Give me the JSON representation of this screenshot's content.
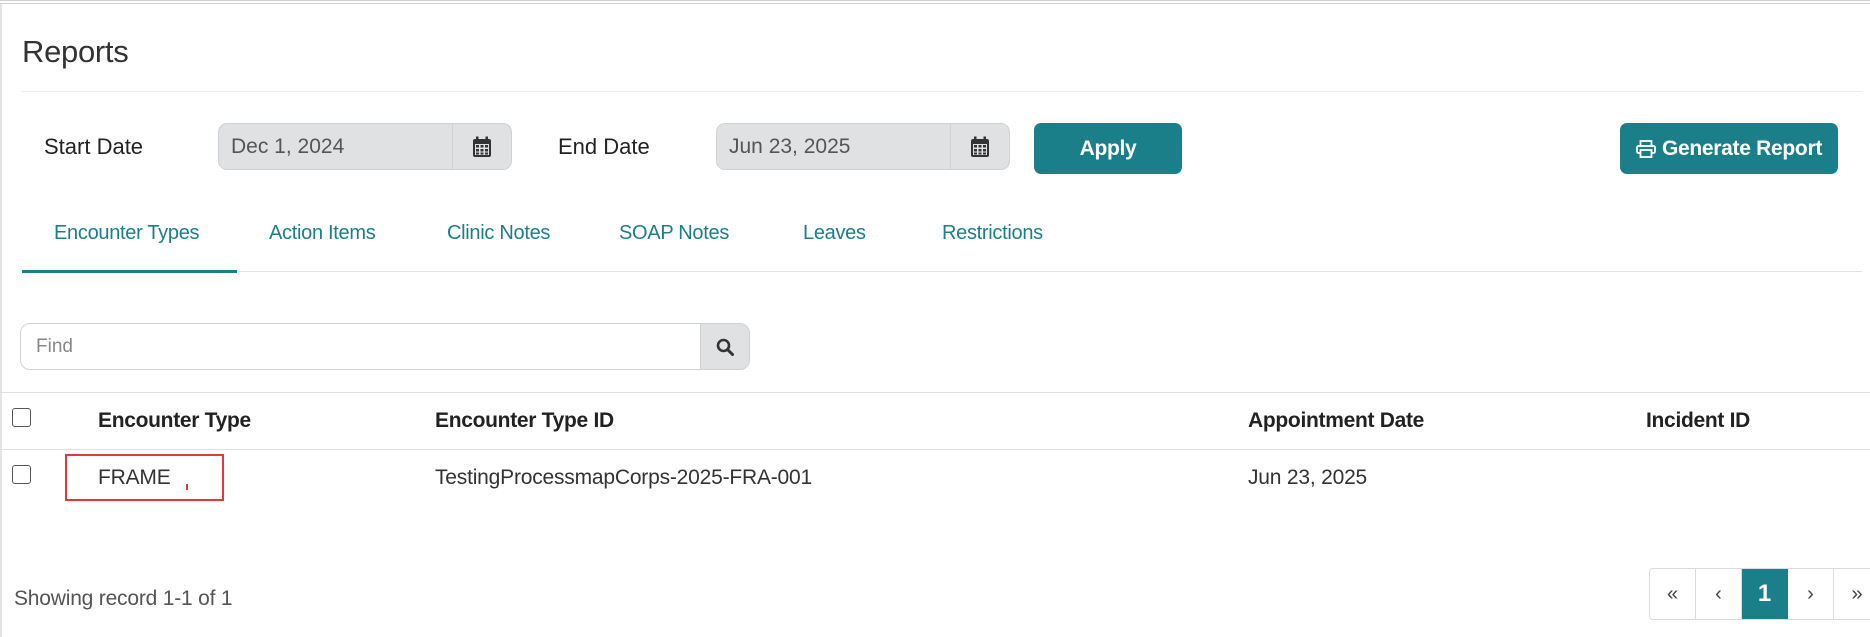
{
  "page": {
    "title": "Reports"
  },
  "filters": {
    "start_label": "Start Date",
    "start_value": "Dec 1, 2024",
    "end_label": "End Date",
    "end_value": "Jun 23, 2025",
    "apply_label": "Apply",
    "generate_label": "Generate Report"
  },
  "tabs": [
    {
      "label": "Encounter Types",
      "active": true
    },
    {
      "label": "Action Items"
    },
    {
      "label": "Clinic Notes"
    },
    {
      "label": "SOAP Notes"
    },
    {
      "label": "Leaves"
    },
    {
      "label": "Restrictions"
    }
  ],
  "search": {
    "placeholder": "Find"
  },
  "table": {
    "columns": [
      "Encounter Type",
      "Encounter Type ID",
      "Appointment Date",
      "Incident ID"
    ],
    "rows": [
      {
        "encounter_type": "FRAME",
        "encounter_type_id": "TestingProcessmapCorps-2025-FRA-001",
        "appointment_date": "Jun 23, 2025",
        "incident_id": ""
      }
    ]
  },
  "footer": {
    "record_text": "Showing record 1-1 of 1"
  },
  "pagination": {
    "first": "«",
    "prev": "‹",
    "current": "1",
    "next": "›",
    "last": "»"
  },
  "colors": {
    "accent": "#1b7f8a",
    "highlight": "#e53935"
  },
  "icons": {
    "calendar": "calendar-icon",
    "search": "search-icon",
    "print": "print-icon"
  }
}
